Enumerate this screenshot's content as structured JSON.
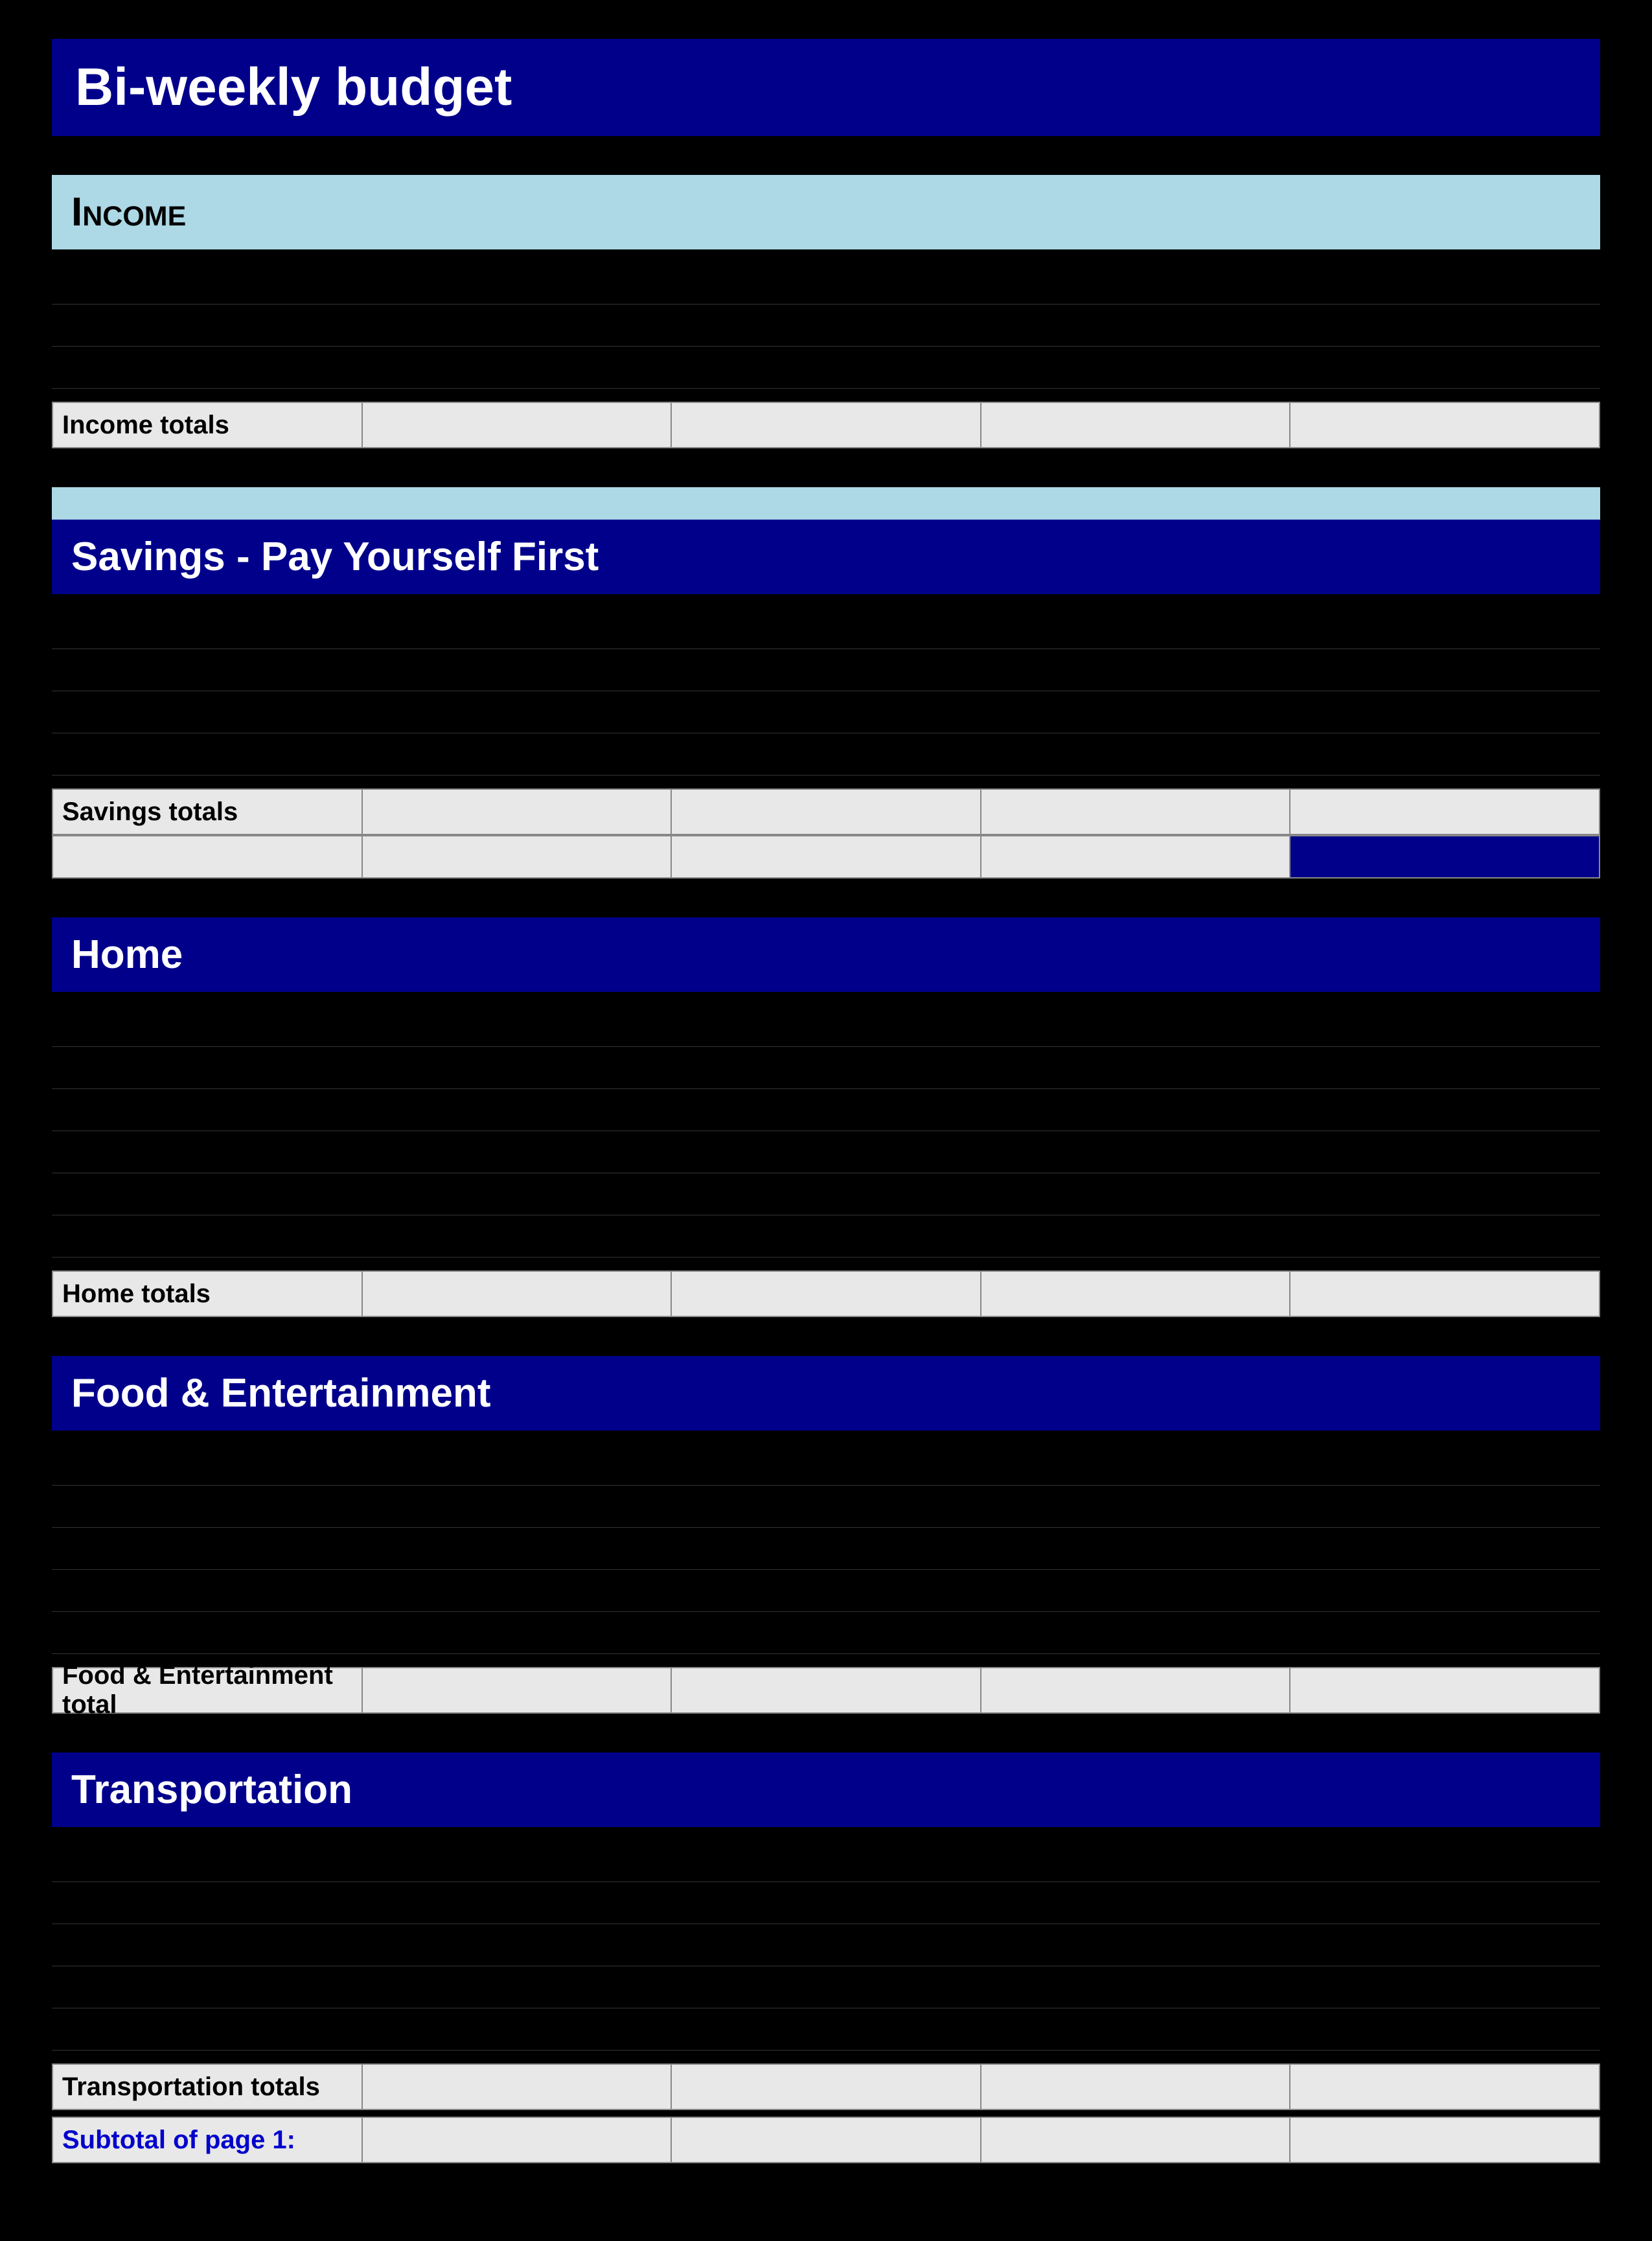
{
  "page": {
    "title": "Bi-weekly  budget",
    "background": "#000000"
  },
  "sections": {
    "income": {
      "header": "Income",
      "totals_label": "Income totals",
      "data_rows": 3,
      "cells": [
        "",
        "",
        "",
        ""
      ]
    },
    "savings": {
      "header": "Savings - Pay Yourself First",
      "totals_label": "Savings totals",
      "data_rows": 4,
      "cells": [
        "",
        "",
        "",
        ""
      ]
    },
    "home": {
      "header": "Home",
      "totals_label": "Home totals",
      "data_rows": 6,
      "cells": [
        "",
        "",
        "",
        ""
      ]
    },
    "food": {
      "header": "Food & Entertainment",
      "totals_label": "Food & Entertainment total",
      "data_rows": 5,
      "cells": [
        "",
        "",
        "",
        ""
      ]
    },
    "transportation": {
      "header": "Transportation",
      "totals_label": "Transportation totals",
      "data_rows": 5,
      "cells": [
        "",
        "",
        "",
        ""
      ]
    },
    "subtotal": {
      "label": "Subtotal of page 1:",
      "cells": [
        "",
        "",
        "",
        ""
      ]
    }
  }
}
